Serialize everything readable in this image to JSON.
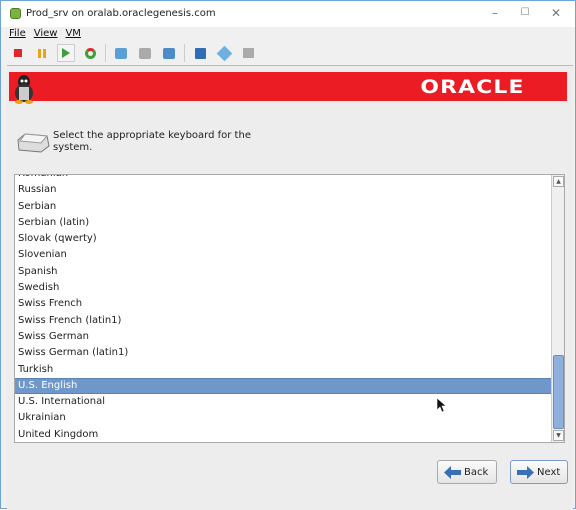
{
  "window": {
    "title": "Prod_srv on oralab.oraclegenesis.com",
    "controls": [
      "minimize",
      "maximize",
      "close"
    ]
  },
  "menu": [
    {
      "label": "File"
    },
    {
      "label": "View"
    },
    {
      "label": "VM"
    }
  ],
  "toolbar": [
    "stop-icon",
    "pause-icon",
    "play-icon",
    "reset-icon",
    "snapshot-icon",
    "snapshot-revert-icon",
    "snapshot-manager-icon",
    "save-icon",
    "settings-icon",
    "clone-icon"
  ],
  "banner": {
    "logo": "ORACLE",
    "color": "#ec1c24"
  },
  "prompt": {
    "text": "Select the appropriate keyboard for the system."
  },
  "keyboards": {
    "items": [
      "Romanian",
      "Russian",
      "Serbian",
      "Serbian (latin)",
      "Slovak (qwerty)",
      "Slovenian",
      "Spanish",
      "Swedish",
      "Swiss French",
      "Swiss French (latin1)",
      "Swiss German",
      "Swiss German (latin1)",
      "Turkish",
      "U.S. English",
      "U.S. International",
      "Ukrainian",
      "United Kingdom"
    ],
    "selected": "U.S. English",
    "selection_color": "#7097c9"
  },
  "buttons": {
    "back": "Back",
    "next": "Next"
  }
}
